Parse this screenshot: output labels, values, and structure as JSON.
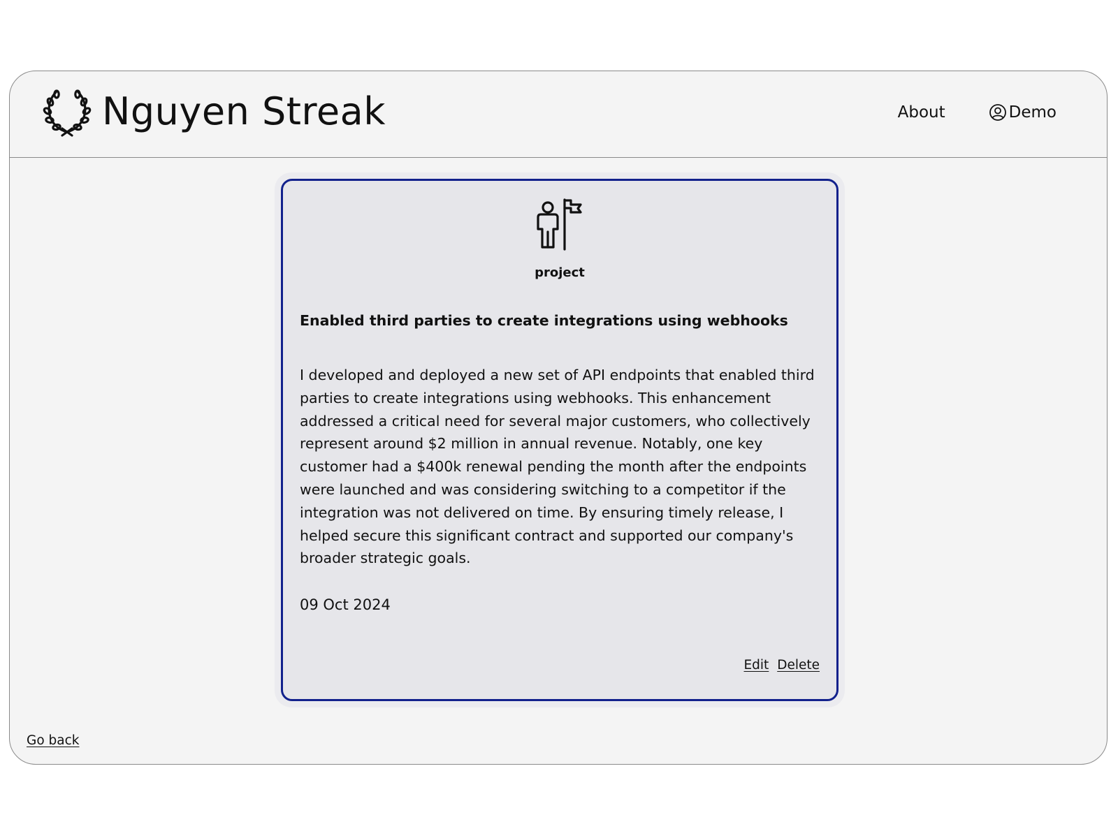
{
  "header": {
    "brand_title": "Nguyen Streak",
    "logo_icon": "laurel-wreath-icon",
    "nav": {
      "about": "About",
      "user": "Demo",
      "user_icon": "user-circle-icon"
    }
  },
  "card": {
    "type_icon": "person-with-flag-icon",
    "type_label": "project",
    "title": "Enabled third parties to create integrations using webhooks",
    "body": "I developed and deployed a new set of API endpoints that enabled third parties to create integrations using webhooks. This enhancement addressed a critical need for several major customers, who collectively represent around $2 million in annual revenue. Notably, one key customer had a $400k renewal pending the month after the endpoints were launched and was considering switching to a competitor if the integration was not delivered on time. By ensuring timely release, I helped secure this significant contract and supported our company's broader strategic goals.",
    "date": "09 Oct 2024",
    "edit_label": "Edit",
    "delete_label": "Delete",
    "border_color": "#12218c"
  },
  "footer": {
    "go_back": "Go back"
  }
}
